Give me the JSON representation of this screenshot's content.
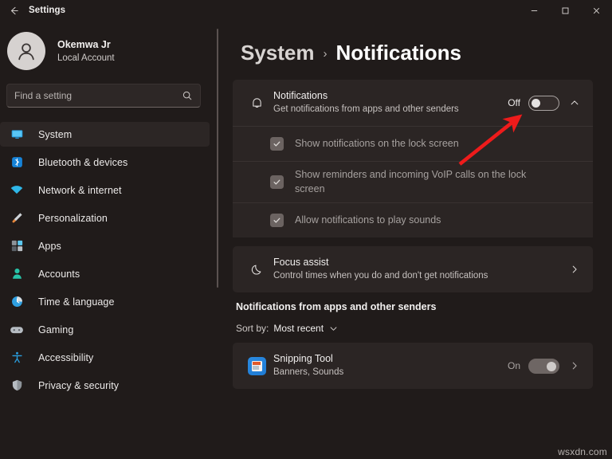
{
  "window": {
    "title": "Settings",
    "back_icon": "back-arrow-icon",
    "minimize_label": "Minimize",
    "maximize_label": "Maximize",
    "close_label": "Close"
  },
  "sidebar": {
    "profile": {
      "name": "Okemwa Jr",
      "subtitle": "Local Account",
      "avatar_icon": "person-avatar-icon"
    },
    "search": {
      "placeholder": "Find a setting",
      "value": "",
      "icon": "search-icon"
    },
    "items": [
      {
        "label": "System",
        "icon": "monitor-icon",
        "selected": true
      },
      {
        "label": "Bluetooth & devices",
        "icon": "bluetooth-icon",
        "selected": false
      },
      {
        "label": "Network & internet",
        "icon": "wifi-icon",
        "selected": false
      },
      {
        "label": "Personalization",
        "icon": "paintbrush-icon",
        "selected": false
      },
      {
        "label": "Apps",
        "icon": "apps-grid-icon",
        "selected": false
      },
      {
        "label": "Accounts",
        "icon": "account-person-icon",
        "selected": false
      },
      {
        "label": "Time & language",
        "icon": "clock-icon",
        "selected": false
      },
      {
        "label": "Gaming",
        "icon": "gamepad-icon",
        "selected": false
      },
      {
        "label": "Accessibility",
        "icon": "accessibility-icon",
        "selected": false
      },
      {
        "label": "Privacy & security",
        "icon": "shield-icon",
        "selected": false
      }
    ]
  },
  "breadcrumb": {
    "parent": "System",
    "separator": "›",
    "current": "Notifications"
  },
  "main": {
    "notifications_card": {
      "icon": "bell-icon",
      "title": "Notifications",
      "subtitle": "Get notifications from apps and other senders",
      "toggle_state": "Off",
      "toggle_on": false,
      "expander_icon": "chevron-up-icon",
      "expanded": true
    },
    "sub_options": [
      {
        "label": "Show notifications on the lock screen",
        "checked": true,
        "disabled": true
      },
      {
        "label": "Show reminders and incoming VoIP calls on the lock screen",
        "checked": true,
        "disabled": true
      },
      {
        "label": "Allow notifications to play sounds",
        "checked": true,
        "disabled": true
      }
    ],
    "focus_assist": {
      "icon": "moon-icon",
      "title": "Focus assist",
      "subtitle": "Control times when you do and don't get notifications",
      "chevron_icon": "chevron-right-icon"
    },
    "apps_section": {
      "heading": "Notifications from apps and other senders",
      "sort_prefix": "Sort by:",
      "sort_value": "Most recent",
      "sort_chevron_icon": "chevron-down-icon"
    },
    "app_rows": [
      {
        "name": "Snipping Tool",
        "detail": "Banners, Sounds",
        "state": "On",
        "toggle_on": true,
        "icon": "snipping-tool-icon",
        "chevron_icon": "chevron-right-icon"
      }
    ]
  },
  "annotation": {
    "type": "red-arrow",
    "color": "#ee1b1b",
    "points_to": "notifications-toggle"
  },
  "watermark": {
    "text": "wsxdn.com"
  },
  "colors": {
    "app_background": "#201b1a",
    "card_background": "#2b2524",
    "accent": "#4cc2ff",
    "text_primary": "#f1efee",
    "text_secondary": "#c6c1bf",
    "annotation_red": "#ee1b1b"
  }
}
